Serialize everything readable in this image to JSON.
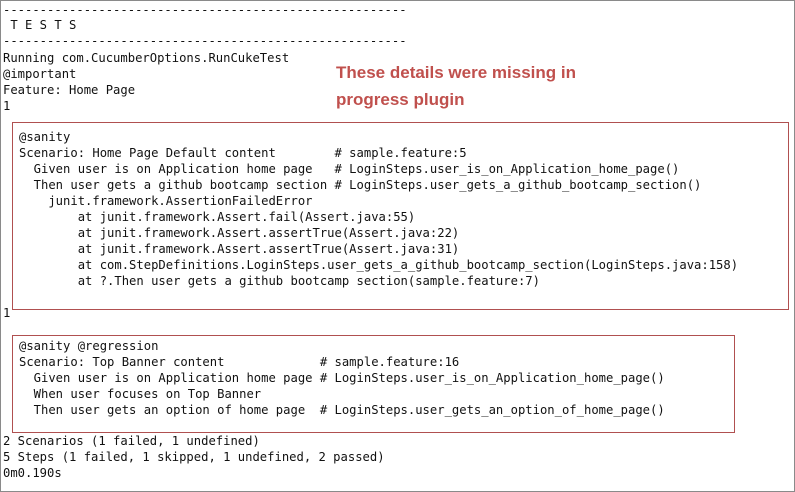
{
  "console": {
    "separator_top": "-------------------------------------------------------",
    "tests_header": " T E S T S",
    "separator_bottom": "-------------------------------------------------------",
    "running": "Running com.CucumberOptions.RunCukeTest",
    "tag_important": "@important",
    "feature": "Feature: Home Page",
    "count_1": "1",
    "scenario1": {
      "tag": "@sanity",
      "title": "Scenario: Home Page Default content        # sample.feature:5",
      "given": "  Given user is on Application home page   # LoginSteps.user_is_on_Application_home_page()",
      "then": "  Then user gets a github bootcamp section # LoginSteps.user_gets_a_github_bootcamp_section()",
      "error": "    junit.framework.AssertionFailedError",
      "trace": [
        "        at junit.framework.Assert.fail(Assert.java:55)",
        "        at junit.framework.Assert.assertTrue(Assert.java:22)",
        "        at junit.framework.Assert.assertTrue(Assert.java:31)",
        "        at com.StepDefinitions.LoginSteps.user_gets_a_github_bootcamp_section(LoginSteps.java:158)",
        "        at ?.Then user gets a github bootcamp section(sample.feature:7)"
      ]
    },
    "count_2": "1",
    "scenario2": {
      "tag": "@sanity @regression",
      "title": "Scenario: Top Banner content             # sample.feature:16",
      "given": "  Given user is on Application home page # LoginSteps.user_is_on_Application_home_page()",
      "when": "  When user focuses on Top Banner",
      "then": "  Then user gets an option of home page  # LoginSteps.user_gets_an_option_of_home_page()"
    },
    "summary_scenarios": "2 Scenarios (1 failed, 1 undefined)",
    "summary_steps": "5 Steps (1 failed, 1 skipped, 1 undefined, 2 passed)",
    "duration": "0m0.190s"
  },
  "annotation": {
    "line1": "These details were missing in",
    "line2": "progress plugin"
  },
  "colors": {
    "annotation_text": "#c0504d",
    "box_border": "#b05050",
    "frame_border": "#8a8a8a"
  }
}
